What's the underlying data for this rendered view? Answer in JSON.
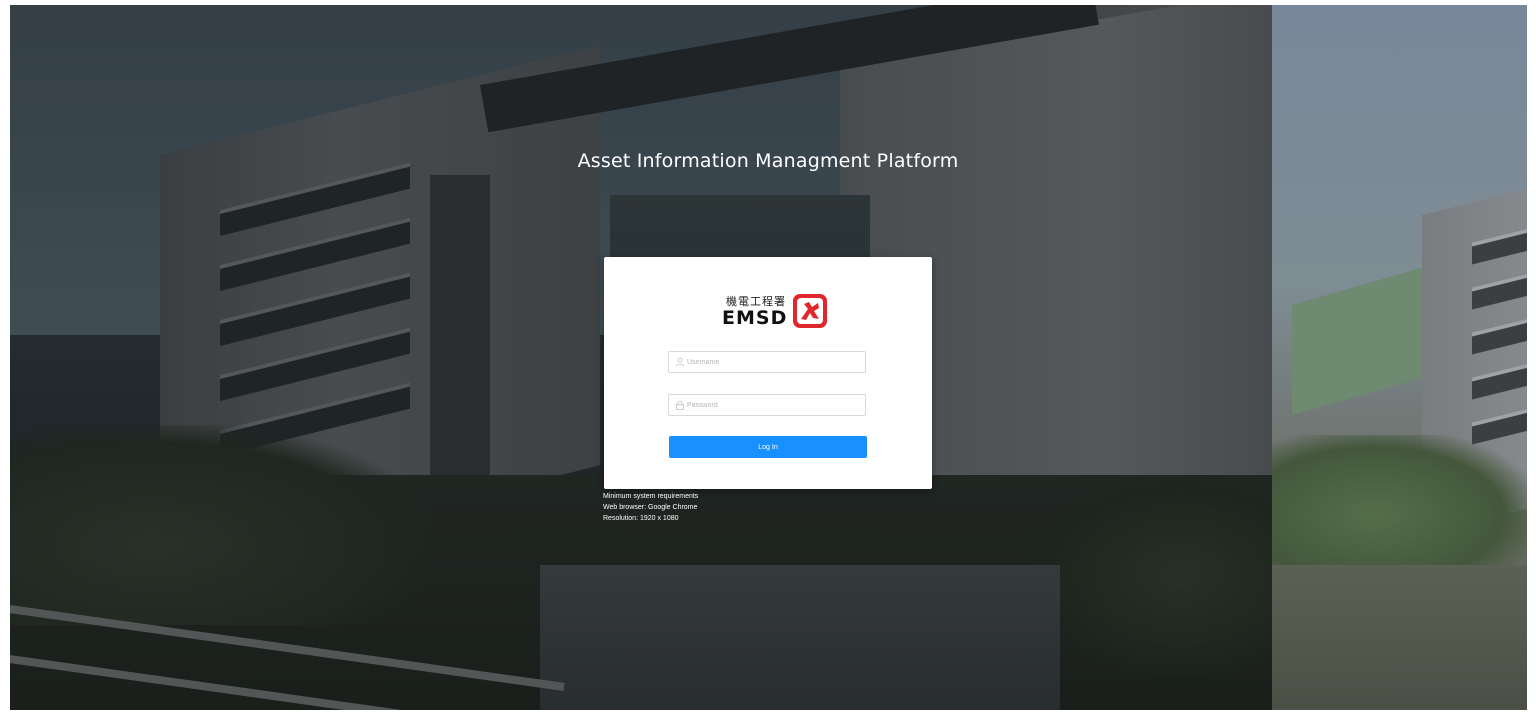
{
  "page": {
    "title": "Asset Information Managment Platform"
  },
  "login": {
    "logo": {
      "chinese_text": "機電工程署",
      "abbreviation": "EMSD",
      "mark_color": "#e0272d"
    },
    "username": {
      "placeholder": "Username",
      "value": "",
      "icon": "user-icon"
    },
    "password": {
      "placeholder": "Password",
      "value": "",
      "icon": "lock-icon"
    },
    "submit_label": "Log In",
    "accent_color": "#1890ff"
  },
  "requirements": {
    "heading": "Minimum system requirements",
    "browser": "Web browser:  Google Chrome",
    "resolution": "Resolution:  1920 x 1080"
  }
}
